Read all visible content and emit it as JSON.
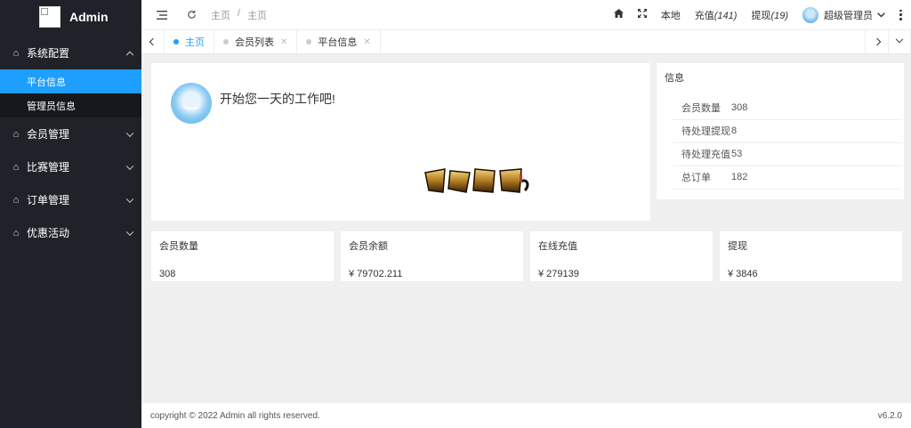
{
  "app": {
    "title": "Admin"
  },
  "sidebar": {
    "groups": [
      {
        "label": "系统配置",
        "expanded": true,
        "icon": "home-outline-icon",
        "items": [
          {
            "label": "平台信息",
            "active": true
          },
          {
            "label": "管理员信息",
            "active": false
          }
        ]
      },
      {
        "label": "会员管理",
        "expanded": false,
        "icon": "home-outline-icon"
      },
      {
        "label": "比赛管理",
        "expanded": false,
        "icon": "home-outline-icon"
      },
      {
        "label": "订单管理",
        "expanded": false,
        "icon": "home-outline-icon"
      },
      {
        "label": "优惠活动",
        "expanded": false,
        "icon": "home-outline-icon"
      }
    ]
  },
  "header": {
    "breadcrumb": [
      "主页",
      "/",
      "主页"
    ],
    "local_label": "本地",
    "recharge_label": "充值",
    "recharge_count": "(141)",
    "withdraw_label": "提现",
    "withdraw_count": "(19)",
    "user_name": "超级管理员"
  },
  "tabs": [
    {
      "label": "主页",
      "active": true,
      "closable": false
    },
    {
      "label": "会员列表",
      "active": false,
      "closable": true
    },
    {
      "label": "平台信息",
      "active": false,
      "closable": true
    }
  ],
  "welcome": {
    "text": "开始您一天的工作吧!"
  },
  "info": {
    "title": "信息",
    "rows": [
      {
        "key": "会员数量",
        "value": "308"
      },
      {
        "key": "待处理提现",
        "value": "8"
      },
      {
        "key": "待处理充值",
        "value": "53"
      },
      {
        "key": "总订单",
        "value": "182"
      }
    ]
  },
  "cards": [
    {
      "title": "会员数量",
      "value": "308"
    },
    {
      "title": "会员余额",
      "value": "¥ 79702.211"
    },
    {
      "title": "在线充值",
      "value": "¥ 279139"
    },
    {
      "title": "提现",
      "value": "¥ 3846"
    }
  ],
  "footer": {
    "copyright": "copyright © 2022 Admin all rights reserved.",
    "version": "v6.2.0"
  },
  "colors": {
    "sidebar_bg": "#20222a",
    "accent": "#1e9fff"
  }
}
